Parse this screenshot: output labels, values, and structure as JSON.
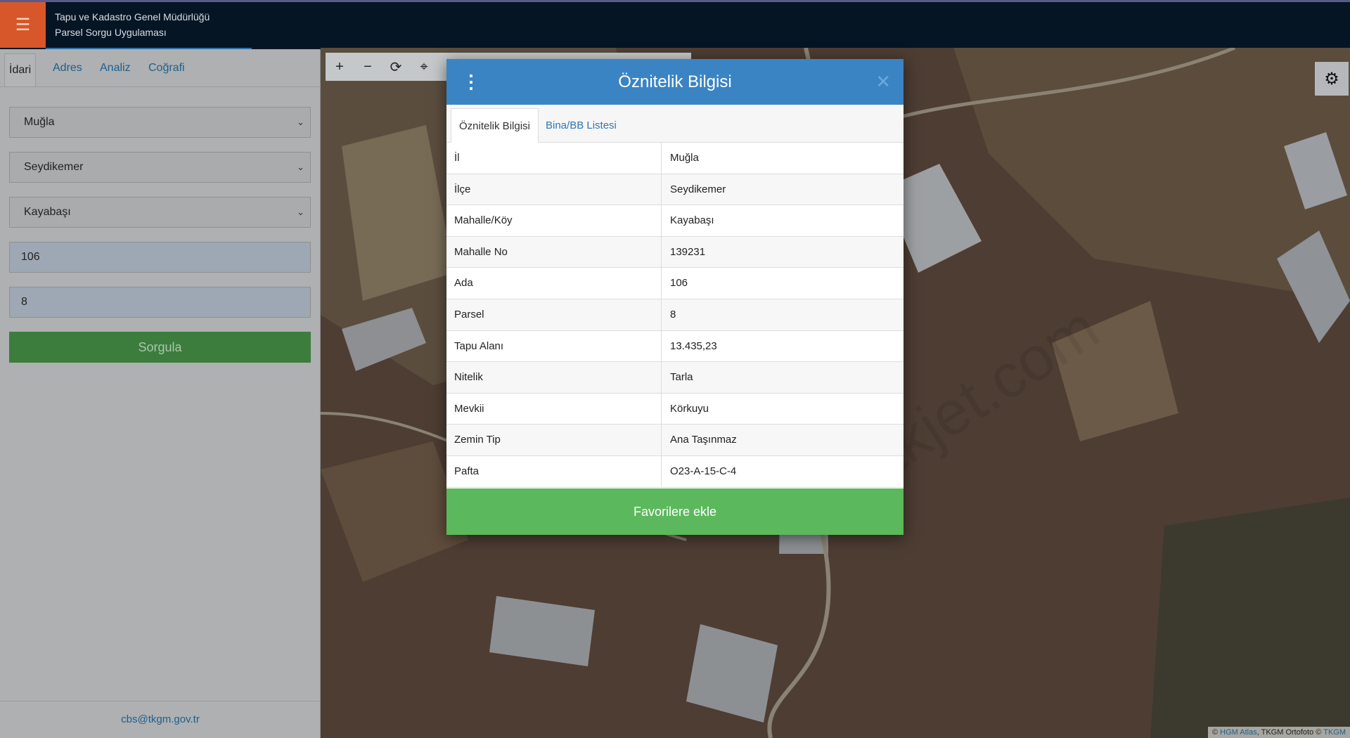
{
  "header": {
    "line1": "Tapu ve Kadastro Genel Müdürlüğü",
    "line2": "Parsel Sorgu Uygulaması"
  },
  "sidebar": {
    "tabs": [
      "İdari",
      "Adres",
      "Analiz",
      "Coğrafi"
    ],
    "il": "Muğla",
    "ilce": "Seydikemer",
    "mahalle": "Kayabaşı",
    "ada": "106",
    "parsel": "8",
    "query_label": "Sorgula",
    "email": "cbs@tkgm.gov.tr"
  },
  "modal": {
    "title": "Öznitelik Bilgisi",
    "tabs": [
      "Öznitelik Bilgisi",
      "Bina/BB Listesi"
    ],
    "rows": [
      {
        "k": "İl",
        "v": "Muğla"
      },
      {
        "k": "İlçe",
        "v": "Seydikemer"
      },
      {
        "k": "Mahalle/Köy",
        "v": "Kayabaşı"
      },
      {
        "k": "Mahalle No",
        "v": "139231"
      },
      {
        "k": "Ada",
        "v": "106"
      },
      {
        "k": "Parsel",
        "v": "8"
      },
      {
        "k": "Tapu Alanı",
        "v": "13.435,23"
      },
      {
        "k": "Nitelik",
        "v": "Tarla"
      },
      {
        "k": "Mevkii",
        "v": "Körkuyu"
      },
      {
        "k": "Zemin Tip",
        "v": "Ana Taşınmaz"
      },
      {
        "k": "Pafta",
        "v": "O23-A-15-C-4"
      }
    ],
    "fav_label": "Favorilere ekle"
  },
  "watermark": "emlakjet.com",
  "attribution": {
    "prefix": "©",
    "link1": "HGM Atlas",
    "mid": ", TKGM Ortofoto ©",
    "link2": "TKGM"
  },
  "colors": {
    "header_bg": "#061524",
    "menu_button": "#d8572a",
    "modal_header": "#3a84c4",
    "primary_green": "#5cb85c"
  }
}
